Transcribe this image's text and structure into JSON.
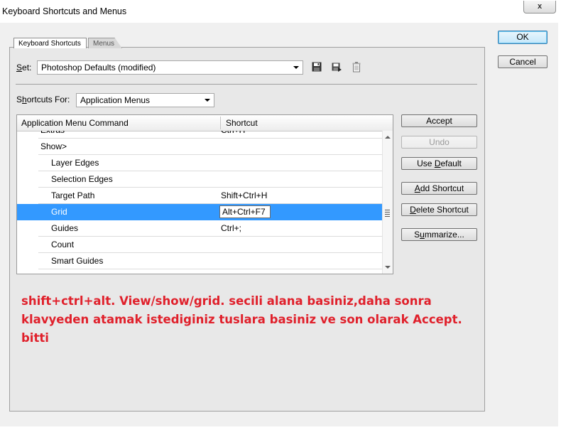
{
  "window": {
    "title": "Keyboard Shortcuts and Menus",
    "close_glyph": "x"
  },
  "tabs": [
    {
      "label": "Keyboard Shortcuts",
      "active": true
    },
    {
      "label": "Menus",
      "active": false
    }
  ],
  "set": {
    "label_mnemonic": "S",
    "label_rest": "et:",
    "value": "Photoshop Defaults (modified)"
  },
  "set_icons": [
    "save-icon",
    "save-as-icon",
    "trash-icon"
  ],
  "shortcuts_for": {
    "label_pre": "S",
    "label_mnemonic": "h",
    "label_rest": "ortcuts For:",
    "value": "Application Menus"
  },
  "table": {
    "columns": [
      "Application Menu Command",
      "Shortcut"
    ],
    "rows": [
      {
        "command": "Extras",
        "shortcut": "Ctrl+H",
        "level": 1
      },
      {
        "command": "Show>",
        "shortcut": "",
        "level": 1
      },
      {
        "command": "Layer Edges",
        "shortcut": "",
        "level": 2
      },
      {
        "command": "Selection Edges",
        "shortcut": "",
        "level": 2
      },
      {
        "command": "Target Path",
        "shortcut": "Shift+Ctrl+H",
        "level": 2
      },
      {
        "command": "Grid",
        "shortcut": "Alt+Ctrl+F7",
        "level": 2,
        "selected": true
      },
      {
        "command": "Guides",
        "shortcut": "Ctrl+;",
        "level": 2
      },
      {
        "command": "Count",
        "shortcut": "",
        "level": 2
      },
      {
        "command": "Smart Guides",
        "shortcut": "",
        "level": 2
      }
    ]
  },
  "buttons": {
    "ok": "OK",
    "cancel": "Cancel",
    "accept": "Accept",
    "undo": "Undo",
    "use_default": {
      "pre": "Use ",
      "mn": "D",
      "post": "efault"
    },
    "add_shortcut": {
      "pre": "",
      "mn": "A",
      "post": "dd Shortcut"
    },
    "delete_shortcut": {
      "pre": "",
      "mn": "D",
      "post": "elete Shortcut"
    },
    "summarize": {
      "pre": "S",
      "mn": "u",
      "post": "mmarize..."
    }
  },
  "annotation": [
    "shift+ctrl+alt. View/show/grid. secili alana basiniz,daha sonra",
    "klavyeden atamak istediginiz tuslara basiniz ve son olarak Accept.",
    "bitti"
  ],
  "colors": {
    "selection": "#3399ff",
    "annotation": "#e0202b"
  }
}
